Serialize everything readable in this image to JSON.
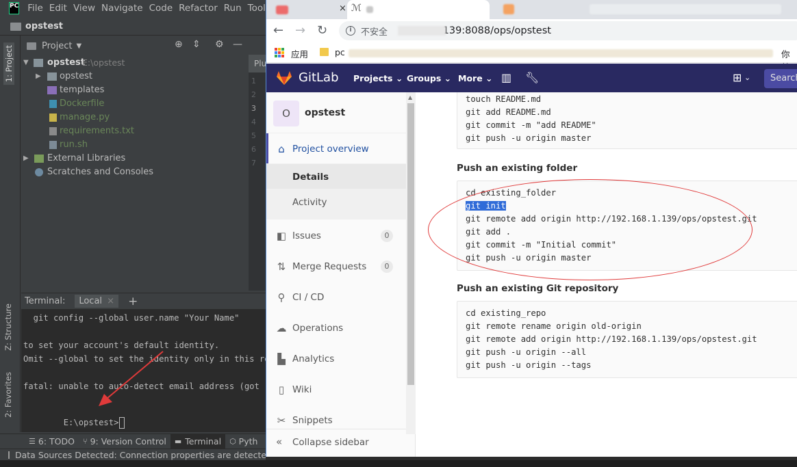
{
  "ide": {
    "logo": "PC",
    "menu": [
      "File",
      "Edit",
      "View",
      "Navigate",
      "Code",
      "Refactor",
      "Run",
      "Tools"
    ],
    "nav_title": "opstest",
    "project_panel_label": "Project",
    "side_tabs": {
      "project": "1: Project",
      "structure": "Z: Structure",
      "favorites": "2: Favorites"
    },
    "tree": [
      {
        "name": "opstest",
        "path": "E:\\opstest",
        "type": "root"
      },
      {
        "name": "opstest",
        "type": "folder"
      },
      {
        "name": "templates",
        "type": "folder"
      },
      {
        "name": "Dockerfile",
        "type": "file"
      },
      {
        "name": "manage.py",
        "type": "file"
      },
      {
        "name": "requirements.txt",
        "type": "file"
      },
      {
        "name": "run.sh",
        "type": "file"
      },
      {
        "name": "External Libraries",
        "type": "lib"
      },
      {
        "name": "Scratches and Consoles",
        "type": "scratch"
      }
    ],
    "editor_tab": "Plu",
    "gutter": [
      "1",
      "2",
      "3",
      "4",
      "5",
      "6",
      "7"
    ],
    "terminal": {
      "label": "Terminal:",
      "tab": "Local",
      "lines": [
        "  git config --global user.name \"Your Name\"",
        "",
        "to set your account's default identity.",
        "Omit --global to set the identity only in this repo",
        "",
        "fatal: unable to auto-detect email address (got 'Adm",
        "",
        "E:\\opstest>"
      ]
    },
    "bottom_tabs": [
      "6: TODO",
      "9: Version Control",
      "Terminal",
      "Pyth"
    ],
    "status": "Data Sources Detected: Connection properties are detected."
  },
  "browser": {
    "omnibox": {
      "security": "不安全",
      "url": ".139:8088/ops/opstest"
    },
    "bookmarks": {
      "apps": "应用",
      "first": "pc",
      "far_right": "你就"
    }
  },
  "gitlab": {
    "brand": "GitLab",
    "menu": [
      "Projects",
      "Groups",
      "More"
    ],
    "search_placeholder": "Search",
    "project": {
      "avatar": "O",
      "name": "opstest"
    },
    "sidebar": {
      "overview": "Project overview",
      "details": "Details",
      "activity": "Activity",
      "issues": "Issues",
      "issues_count": "0",
      "merge_requests": "Merge Requests",
      "mr_count": "0",
      "cicd": "CI / CD",
      "operations": "Operations",
      "analytics": "Analytics",
      "wiki": "Wiki",
      "snippets": "Snippets",
      "collapse": "Collapse sidebar"
    },
    "block_top": [
      "touch README.md",
      "git add README.md",
      "git commit -m \"add README\"",
      "git push -u origin master"
    ],
    "existing_folder_title": "Push an existing folder",
    "existing_folder": {
      "line1": "cd existing_folder",
      "selected": "git init",
      "rest": [
        "git remote add origin http://192.168.1.139/ops/opstest.git",
        "git add .",
        "git commit -m \"Initial commit\"",
        "git push -u origin master"
      ]
    },
    "existing_repo_title": "Push an existing Git repository",
    "existing_repo": [
      "cd existing_repo",
      "git remote rename origin old-origin",
      "git remote add origin http://192.168.1.139/ops/opstest.git",
      "git push -u origin --all",
      "git push -u origin --tags"
    ]
  },
  "colors": {
    "gitlab_nav": "#292961",
    "annotation_red": "#e03a3a",
    "selection": "#2f6bd8"
  }
}
